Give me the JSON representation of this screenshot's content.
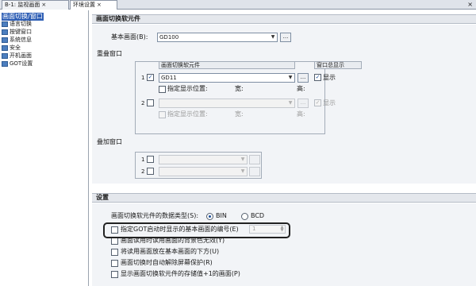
{
  "tabs": [
    {
      "label": "B-1: 监视画面",
      "close": "×"
    },
    {
      "label": "环境设置",
      "close": "×"
    }
  ],
  "tree": {
    "items": [
      {
        "label": "画面切换/窗口",
        "selected": true
      },
      {
        "label": "语言切换",
        "selected": false
      },
      {
        "label": "按键窗口",
        "selected": false
      },
      {
        "label": "系统信息",
        "selected": false
      },
      {
        "label": "安全",
        "selected": false
      },
      {
        "label": "开机画面",
        "selected": false
      },
      {
        "label": "GOT设置",
        "selected": false
      }
    ]
  },
  "screen_switch": {
    "header": "画面切换软元件",
    "base_label": "基本画面(B):",
    "base_value": "GD100",
    "overlap_title": "重叠窗口",
    "col_device": "画面切换软元件",
    "col_show": "窗口总显示",
    "rows": [
      {
        "num": "1",
        "checked": true,
        "device": "GD11",
        "show": "显示",
        "pos_label": "指定显示位置:",
        "w": "宽:",
        "h": "高:"
      },
      {
        "num": "2",
        "checked": false,
        "device": "",
        "show": "显示",
        "pos_label": "指定显示位置:",
        "w": "宽:",
        "h": "高:"
      }
    ],
    "superimpose_title": "叠加窗口",
    "super_rows": [
      {
        "num": "1"
      },
      {
        "num": "2"
      }
    ]
  },
  "settings": {
    "header": "设置",
    "data_type_label": "画面切换软元件的数据类型(S):",
    "bin": "BIN",
    "bcd": "BCD",
    "options": [
      "指定GOT启动时显示的基本画面的编号(E)",
      "画面读用时读用画面的背景色无效(Y)",
      "将读用画面放在基本画面的下方(U)",
      "画面切换时自动解除屏幕保护(R)",
      "显示画面切换软元件的存储值+1的画面(P)"
    ],
    "spin_value": "1"
  },
  "window_close": "×"
}
